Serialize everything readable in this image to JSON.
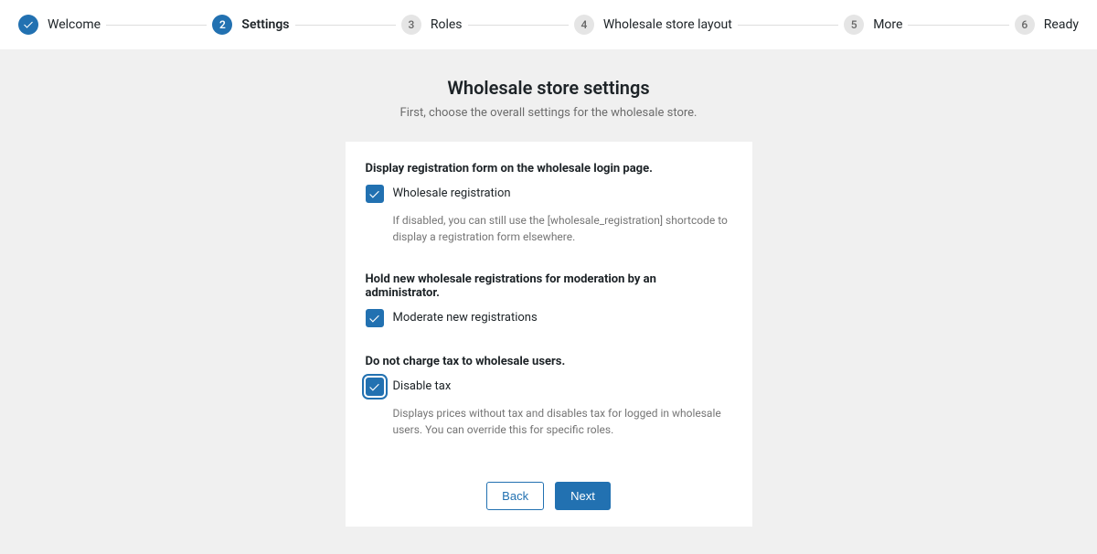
{
  "stepper": {
    "steps": [
      {
        "num": "✓",
        "label": "Welcome",
        "state": "completed"
      },
      {
        "num": "2",
        "label": "Settings",
        "state": "active"
      },
      {
        "num": "3",
        "label": "Roles",
        "state": "upcoming"
      },
      {
        "num": "4",
        "label": "Wholesale store layout",
        "state": "upcoming"
      },
      {
        "num": "5",
        "label": "More",
        "state": "upcoming"
      },
      {
        "num": "6",
        "label": "Ready",
        "state": "upcoming"
      }
    ]
  },
  "page": {
    "title": "Wholesale store settings",
    "subtitle": "First, choose the overall settings for the wholesale store."
  },
  "sections": {
    "registration": {
      "heading": "Display registration form on the wholesale login page.",
      "checkbox_label": "Wholesale registration",
      "checked": true,
      "helper": "If disabled, you can still use the [wholesale_registration] shortcode to display a registration form elsewhere."
    },
    "moderation": {
      "heading": "Hold new wholesale registrations for moderation by an administrator.",
      "checkbox_label": "Moderate new registrations",
      "checked": true
    },
    "tax": {
      "heading": "Do not charge tax to wholesale users.",
      "checkbox_label": "Disable tax",
      "checked": true,
      "focused": true,
      "helper": "Displays prices without tax and disables tax for logged in wholesale users. You can override this for specific roles."
    }
  },
  "actions": {
    "back": "Back",
    "next": "Next"
  },
  "colors": {
    "primary": "#2271b1",
    "muted_bg": "#f0f0f0"
  }
}
